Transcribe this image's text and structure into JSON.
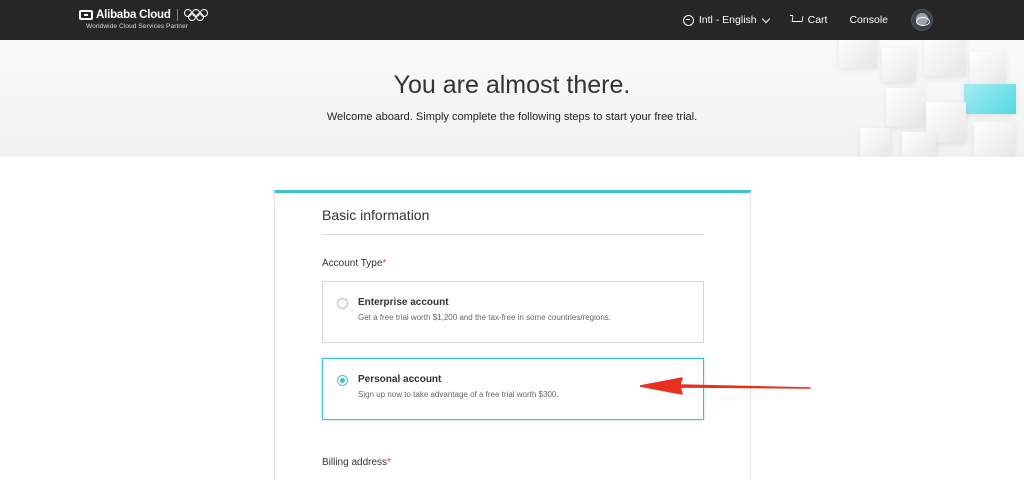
{
  "nav": {
    "logo_text": "Alibaba Cloud",
    "logo_sub": "Worldwide Cloud Services Partner",
    "language": "Intl - English",
    "cart": "Cart",
    "console": "Console"
  },
  "hero": {
    "title": "You are almost there.",
    "subtitle": "Welcome aboard. Simply complete the following steps to start your free trial."
  },
  "form": {
    "section_title": "Basic information",
    "account_type_label": "Account Type",
    "required_mark": "*",
    "options": [
      {
        "title": "Enterprise account",
        "description": "Get a free trial worth $1,200 and the tax-free in some countries/regions.",
        "selected": false
      },
      {
        "title": "Personal account",
        "description": "Sign up now to take advantage of a free trial worth $300.",
        "selected": true
      }
    ],
    "billing_label": "Billing address"
  },
  "colors": {
    "accent": "#3ec1d3",
    "topbar": "#262626",
    "required": "#e4393c",
    "annotation_arrow": "#e8301c"
  },
  "icons": [
    "globe-icon",
    "chevron-down-icon",
    "cart-icon",
    "avatar",
    "olympic-rings-icon"
  ]
}
